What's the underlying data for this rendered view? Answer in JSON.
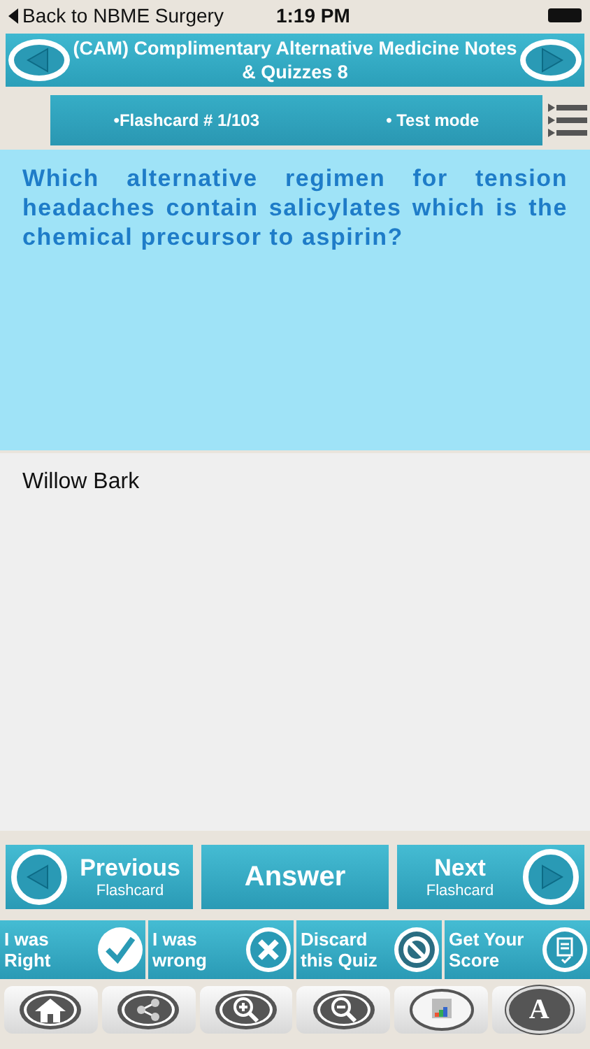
{
  "status_bar": {
    "back": "Back to NBME Surgery",
    "time": "1:19 PM"
  },
  "header": {
    "title": "(CAM) Complimentary Alternative Medicine Notes & Quizzes 8"
  },
  "info_bar": {
    "flashcard": "•Flashcard #  1/103",
    "mode": "• Test mode"
  },
  "question": "Which alternative regimen for tension headaches contain salicylates which is the chemical precursor to aspirin?",
  "answer": "Willow Bark",
  "nav": {
    "previous": {
      "label": "Previous",
      "sub": "Flashcard"
    },
    "answer": "Answer",
    "next": {
      "label": "Next",
      "sub": "Flashcard"
    }
  },
  "actions": [
    {
      "kind": "right",
      "label": "I was Right"
    },
    {
      "kind": "wrong",
      "label": "I was wrong"
    },
    {
      "kind": "discard",
      "label": "Discard this Quiz"
    },
    {
      "kind": "score",
      "label": "Get Your Score"
    }
  ],
  "toolbar": [
    {
      "kind": "home"
    },
    {
      "kind": "share"
    },
    {
      "kind": "zoom-in"
    },
    {
      "kind": "zoom-out"
    },
    {
      "kind": "theme"
    },
    {
      "kind": "font",
      "text": "A"
    }
  ]
}
